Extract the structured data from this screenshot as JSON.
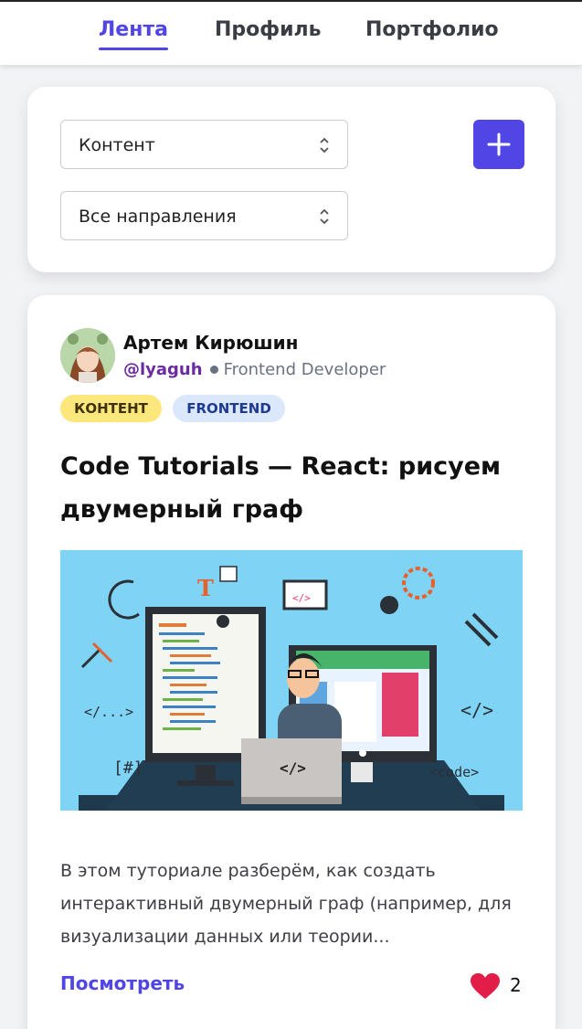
{
  "nav": {
    "tabs": [
      {
        "label": "Лента",
        "active": true
      },
      {
        "label": "Профиль",
        "active": false
      },
      {
        "label": "Портфолио",
        "active": false
      }
    ]
  },
  "filters": {
    "type_select": {
      "value": "Контент"
    },
    "direction_select": {
      "value": "Все направления"
    },
    "add_button_icon": "plus-icon"
  },
  "post": {
    "author": {
      "name": "Артем Кирюшин",
      "handle": "@lyaguh",
      "role": "Frontend Developer"
    },
    "badges": [
      {
        "label": "КОНТЕНТ",
        "color": "#fbe77c"
      },
      {
        "label": "FRONTEND",
        "color": "#dbe8fb"
      }
    ],
    "title": "Code Tutorials — React: рисуем двумерный граф",
    "excerpt": "В этом туториале разберём, как создать интерактивный двумерный граф (например, для визуализации данных или теории...",
    "view_link": "Посмотреть",
    "likes": "2",
    "illustration_labels": {
      "code_tag": "</>",
      "dots_tag": "</...>",
      "hash_tag": "[#]",
      "code_word": "<code>",
      "screen_tag": "</>",
      "laptop_tag": "</>",
      "t_letter": "T"
    }
  },
  "colors": {
    "accent": "#5145e5",
    "handle": "#6a2c9e",
    "like": "#e11d48"
  }
}
